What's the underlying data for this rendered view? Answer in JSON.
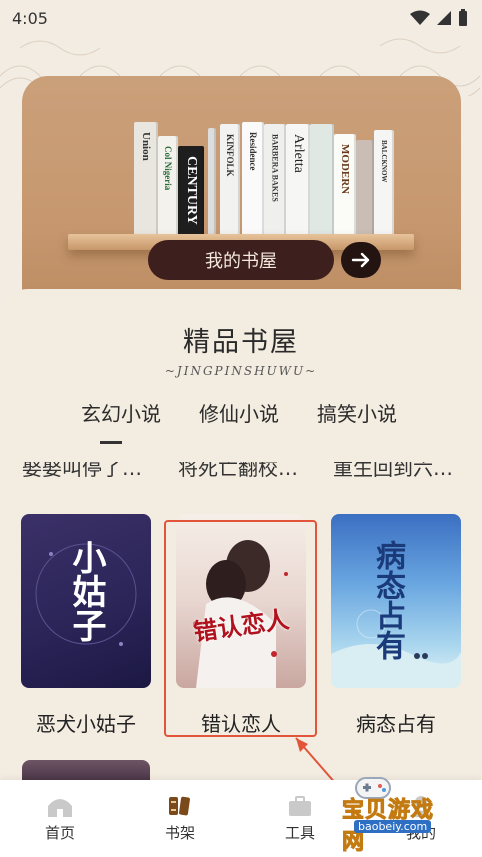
{
  "status_bar": {
    "time": "4:05"
  },
  "hero": {
    "my_books_label": "我的书屋",
    "book_spines": [
      "Union",
      "Col Nigeria",
      "CENTURY",
      "KINFOLK",
      "Residence",
      "BARBERA BAKES",
      "Arletta",
      "MODERN",
      "BALCKNOW"
    ]
  },
  "section": {
    "title": "精品书屋",
    "subtitle": "~JINGPINSHUWU~"
  },
  "tabs": [
    {
      "label": "玄幻小说",
      "active": true
    },
    {
      "label": "修仙小说",
      "active": false
    },
    {
      "label": "搞笑小说",
      "active": false
    }
  ],
  "clipped_titles": [
    "娶娶叫停了…",
    "将死亡翻校…",
    "重生回到六…"
  ],
  "books": [
    {
      "title": "恶犬小姑子",
      "cover_text": "小姑子"
    },
    {
      "title": "错认恋人",
      "cover_text": "错认恋人"
    },
    {
      "title": "病态占有",
      "cover_text": "病态占有"
    }
  ],
  "bottom_nav": [
    {
      "label": "首页",
      "icon": "home-icon"
    },
    {
      "label": "书架",
      "icon": "bookshelf-icon"
    },
    {
      "label": "工具",
      "icon": "toolbox-icon"
    },
    {
      "label": "我的",
      "icon": "profile-icon"
    }
  ],
  "watermark": {
    "text": "宝贝游戏网",
    "url": "baobeiy.com"
  },
  "colors": {
    "hero_bg": "#c79a70",
    "pill": "#3d1f1d",
    "highlight": "#e2553a",
    "bookshelf_active": "#7a4a1a"
  }
}
